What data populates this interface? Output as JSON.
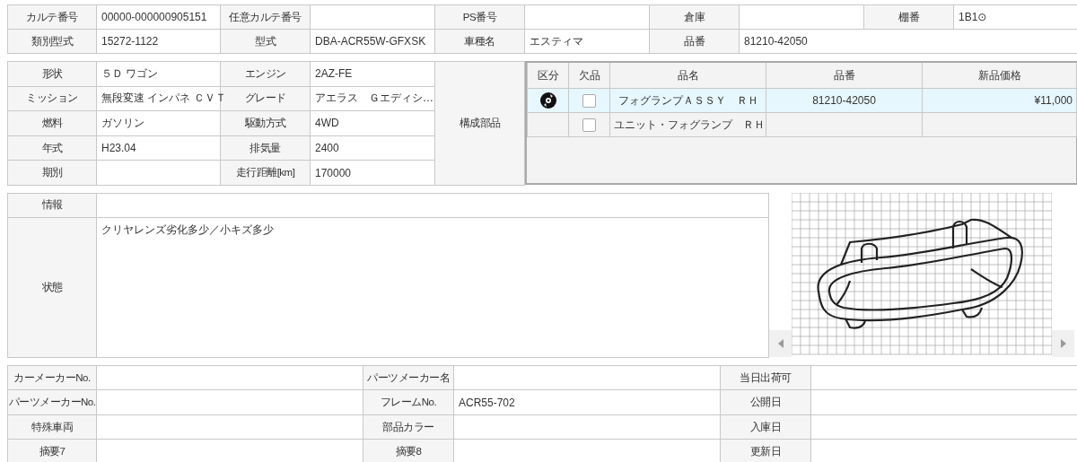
{
  "header_rows": [
    [
      {
        "label": "カルテ番号",
        "value": "00000-000000905151"
      },
      {
        "label": "任意カルテ番号"
      },
      {
        "label": "PS番号"
      },
      {
        "label": "倉庫"
      },
      {
        "label": "棚番",
        "value": "1B1⊙"
      }
    ],
    [
      {
        "label": "類別型式",
        "value": "15272-1122"
      },
      {
        "label": "型式",
        "value": "DBA-ACR55W-GFXSK"
      },
      {
        "label": "車種名",
        "value": "エスティマ"
      },
      {
        "label": "品番",
        "value": "81210-42050"
      }
    ]
  ],
  "vehicle_rows": [
    [
      {
        "label": "形状",
        "value": "５Ｄ ワゴン"
      },
      {
        "label": "エンジン",
        "value": "2AZ-FE"
      }
    ],
    [
      {
        "label": "ミッション",
        "value": "無段変速 インパネ ＣＶＴ"
      },
      {
        "label": "グレード",
        "value": "アエラス　Ｇエディシ…"
      }
    ],
    [
      {
        "label": "燃料",
        "value": "ガソリン"
      },
      {
        "label": "駆動方式",
        "value": "4WD"
      }
    ],
    [
      {
        "label": "年式",
        "value": "H23.04"
      },
      {
        "label": "排気量",
        "value": "2400"
      }
    ],
    [
      {
        "label": "期別"
      },
      {
        "label": "走行距離[km]",
        "value": "170000"
      }
    ]
  ],
  "components_label": "構成部品",
  "parts": {
    "columns": [
      "区分",
      "欠品",
      "品名",
      "品番",
      "新品価格"
    ],
    "rows": [
      {
        "selected": true,
        "disc_icon": true,
        "missing": false,
        "name": "フォグランプＡＳＳＹ　ＲＨ",
        "part_no": "81210-42050",
        "price": "¥11,000"
      },
      {
        "selected": false,
        "disc_icon": false,
        "missing": false,
        "name": "ユニット・フォグランプ　ＲＨ"
      }
    ]
  },
  "info": {
    "label": "情報"
  },
  "condition": {
    "label": "状態",
    "value": "クリヤレンズ劣化多少／小キズ多少"
  },
  "image": {
    "kind": "drawing"
  },
  "bottom_rows": [
    [
      {
        "label": "カーメーカーNo."
      },
      {
        "label": "パーツメーカー名"
      },
      {
        "label": "当日出荷可"
      }
    ],
    [
      {
        "label": "パーツメーカーNo."
      },
      {
        "label": "フレームNo.",
        "value": "ACR55-702"
      },
      {
        "label": "公開日"
      }
    ],
    [
      {
        "label": "特殊車両"
      },
      {
        "label": "部品カラー"
      },
      {
        "label": "入庫日"
      }
    ],
    [
      {
        "label": "摘要7"
      },
      {
        "label": "摘要8"
      },
      {
        "label": "更新日"
      }
    ]
  ]
}
